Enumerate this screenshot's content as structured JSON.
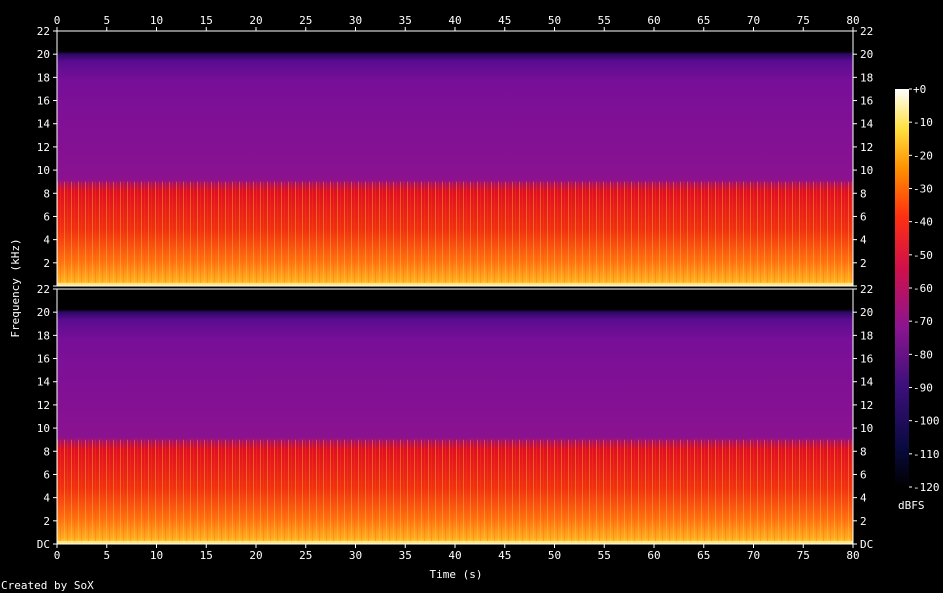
{
  "chart_data": {
    "type": "heatmap",
    "title": "",
    "xlabel": "Time (s)",
    "ylabel": "Frequency (kHz)",
    "xlim": [
      0,
      80
    ],
    "x_ticks": [
      "0",
      "5",
      "10",
      "15",
      "20",
      "25",
      "30",
      "35",
      "40",
      "45",
      "50",
      "55",
      "60",
      "65",
      "70",
      "75",
      "80"
    ],
    "channels": [
      {
        "ylim": [
          0,
          22
        ],
        "y_tick_values": [
          0,
          2,
          4,
          6,
          8,
          10,
          12,
          14,
          16,
          18,
          20,
          22
        ],
        "y_tick_labels": [
          "",
          "2",
          "4",
          "6",
          "8",
          "10",
          "12",
          "14",
          "16",
          "18",
          "20",
          "22"
        ]
      },
      {
        "ylim": [
          0,
          22
        ],
        "y_tick_values": [
          0,
          2,
          4,
          6,
          8,
          10,
          12,
          14,
          16,
          18,
          20,
          22
        ],
        "y_tick_labels": [
          "DC",
          "2",
          "4",
          "6",
          "8",
          "10",
          "12",
          "14",
          "16",
          "18",
          "20",
          "22"
        ]
      }
    ],
    "colorbar": {
      "label": "dBFS",
      "range": [
        -120,
        0
      ],
      "tick_values": [
        0,
        -10,
        -20,
        -30,
        -40,
        -50,
        -60,
        -70,
        -80,
        -90,
        -100,
        -110,
        -120
      ],
      "tick_labels": [
        "+0",
        "-10",
        "-20",
        "-30",
        "-40",
        "-50",
        "-60",
        "-70",
        "-80",
        "-90",
        "-100",
        "-110",
        "-120"
      ]
    },
    "levels_dbfs": {
      "band_0_1_khz": -25,
      "band_1_4_khz": -40,
      "band_4_9_khz": -55,
      "band_9_20_khz": -82,
      "above_20_khz": -120
    }
  },
  "footer": {
    "credit": "Created by SoX"
  }
}
